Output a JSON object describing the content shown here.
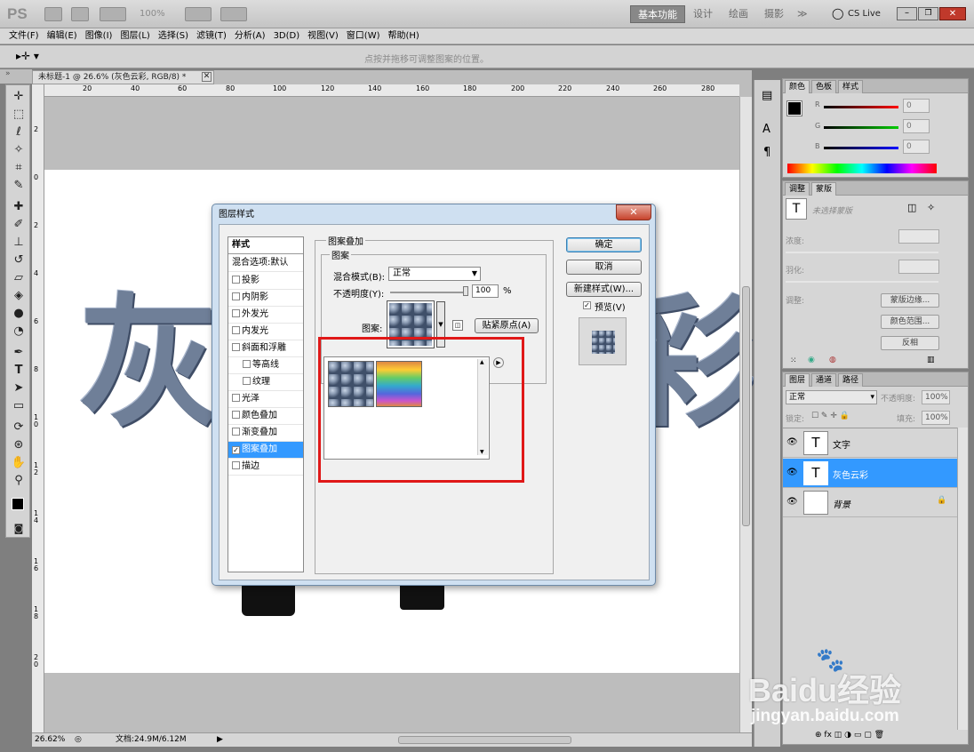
{
  "app": {
    "logo": "PS",
    "zoom": "100%"
  },
  "workspaces": {
    "active": "基本功能",
    "items": [
      "设计",
      "绘画",
      "摄影"
    ],
    "more": "≫",
    "cslive": "CS Live"
  },
  "menu": [
    "文件(F)",
    "编辑(E)",
    "图像(I)",
    "图层(L)",
    "选择(S)",
    "滤镜(T)",
    "分析(A)",
    "3D(D)",
    "视图(V)",
    "窗口(W)",
    "帮助(H)"
  ],
  "options": {
    "hint": "点按并拖移可调整图案的位置。"
  },
  "document": {
    "tab": "未标题-1 @ 26.6% (灰色云彩, RGB/8) *",
    "canvas_text": "灰",
    "canvas_text_right": "彩"
  },
  "ruler": {
    "h": [
      "20",
      "40",
      "60",
      "80",
      "100",
      "120",
      "140",
      "160",
      "180",
      "200",
      "220",
      "240",
      "260",
      "280"
    ],
    "v": [
      "2",
      "0",
      "2",
      "4",
      "6",
      "8",
      "1",
      "0",
      "1",
      "2",
      "1",
      "4",
      "1",
      "6",
      "1",
      "8",
      "2",
      "0"
    ]
  },
  "status": {
    "zoom": "26.62%",
    "doc": "文档:24.9M/6.12M"
  },
  "panel_color": {
    "tabs": [
      "颜色",
      "色板",
      "样式"
    ],
    "labels": [
      "R",
      "G",
      "B"
    ],
    "values": [
      "0",
      "0",
      "0"
    ]
  },
  "panel_adjust": {
    "tabs": [
      "调整",
      "蒙版"
    ],
    "hint": "未选择蒙版",
    "density": "浓度:",
    "feather": "羽化:",
    "refine": "调整:",
    "buttons": [
      "蒙版边缘...",
      "颜色范围...",
      "反相"
    ]
  },
  "panel_layers": {
    "tabs": [
      "图层",
      "通道",
      "路径"
    ],
    "mode": "正常",
    "opacity_label": "不透明度:",
    "opacity": "100%",
    "lock_label": "锁定:",
    "fill_label": "填充:",
    "fill": "100%",
    "layers": [
      {
        "name": "文字",
        "thumb": "T"
      },
      {
        "name": "灰色云彩",
        "thumb": "T"
      },
      {
        "name": "背景",
        "thumb": ""
      }
    ]
  },
  "dialog": {
    "title": "图层样式",
    "close": "✕",
    "styles_header": "样式",
    "blend": "混合选项:默认",
    "items": [
      {
        "label": "投影",
        "checked": false
      },
      {
        "label": "内阴影",
        "checked": false
      },
      {
        "label": "外发光",
        "checked": false
      },
      {
        "label": "内发光",
        "checked": false
      },
      {
        "label": "斜面和浮雕",
        "checked": false
      },
      {
        "label": "等高线",
        "checked": false,
        "indent": true
      },
      {
        "label": "纹理",
        "checked": false,
        "indent": true
      },
      {
        "label": "光泽",
        "checked": false
      },
      {
        "label": "颜色叠加",
        "checked": false
      },
      {
        "label": "渐变叠加",
        "checked": false
      },
      {
        "label": "图案叠加",
        "checked": true,
        "selected": true
      },
      {
        "label": "描边",
        "checked": false
      }
    ],
    "section": "图案叠加",
    "group": "图案",
    "blend_label": "混合模式(B):",
    "blend_value": "正常",
    "opacity_label": "不透明度(Y):",
    "opacity_value": "100",
    "pct": "%",
    "pattern_label": "图案:",
    "snap": "贴紧原点(A)",
    "ok": "确定",
    "cancel": "取消",
    "newstyle": "新建样式(W)...",
    "preview": "预览(V)"
  },
  "watermark": {
    "brand": "Baidu经验",
    "url": "jingyan.baidu.com"
  }
}
